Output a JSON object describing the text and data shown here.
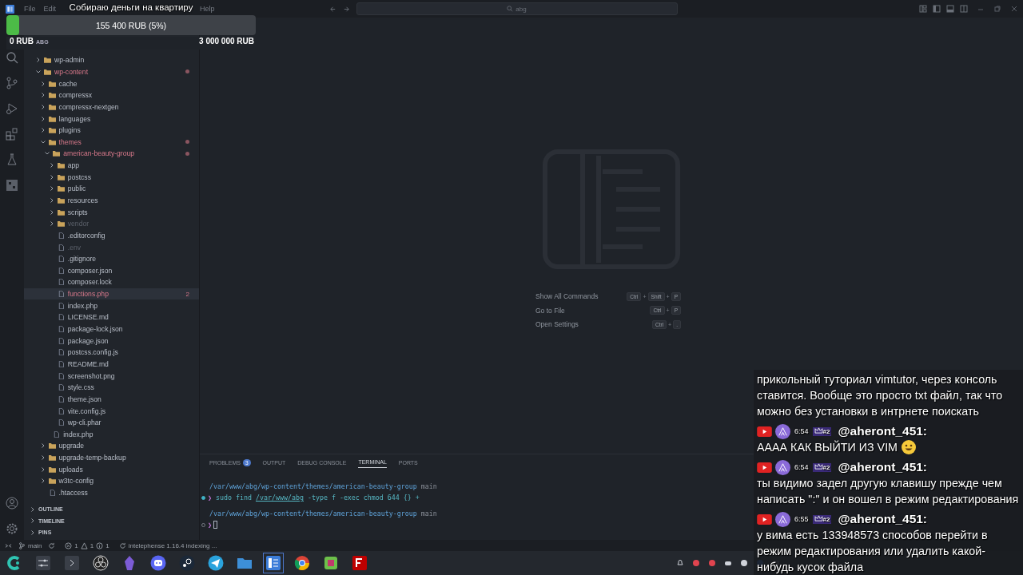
{
  "menu": [
    "File",
    "Edit",
    "Help"
  ],
  "search": {
    "value": "abg"
  },
  "explorer": {
    "tree": [
      {
        "kind": "folder",
        "name": "wp-admin",
        "expanded": false,
        "selected": false,
        "modified": false,
        "ignored": false
      },
      {
        "kind": "folder",
        "name": "wp-content",
        "expanded": true,
        "selected": false,
        "modified": true,
        "ignored": false,
        "children": [
          {
            "kind": "folder",
            "name": "cache",
            "expanded": false,
            "selected": false,
            "modified": false,
            "ignored": false
          },
          {
            "kind": "folder",
            "name": "compressx",
            "expanded": false,
            "selected": false,
            "modified": false,
            "ignored": false
          },
          {
            "kind": "folder",
            "name": "compressx-nextgen",
            "expanded": false,
            "selected": false,
            "modified": false,
            "ignored": false
          },
          {
            "kind": "folder",
            "name": "languages",
            "expanded": false,
            "selected": false,
            "modified": false,
            "ignored": false
          },
          {
            "kind": "folder",
            "name": "plugins",
            "expanded": false,
            "selected": false,
            "modified": false,
            "ignored": false
          },
          {
            "kind": "folder",
            "name": "themes",
            "expanded": true,
            "selected": false,
            "modified": true,
            "ignored": false,
            "children": [
              {
                "kind": "folder",
                "name": "american-beauty-group",
                "expanded": true,
                "selected": false,
                "modified": true,
                "ignored": false,
                "children": [
                  {
                    "kind": "folder",
                    "name": "app",
                    "expanded": false,
                    "selected": false,
                    "modified": false,
                    "ignored": false
                  },
                  {
                    "kind": "folder",
                    "name": "postcss",
                    "expanded": false,
                    "selected": false,
                    "modified": false,
                    "ignored": false
                  },
                  {
                    "kind": "folder",
                    "name": "public",
                    "expanded": false,
                    "selected": false,
                    "modified": false,
                    "ignored": false
                  },
                  {
                    "kind": "folder",
                    "name": "resources",
                    "expanded": false,
                    "selected": false,
                    "modified": false,
                    "ignored": false
                  },
                  {
                    "kind": "folder",
                    "name": "scripts",
                    "expanded": false,
                    "selected": false,
                    "modified": false,
                    "ignored": false
                  },
                  {
                    "kind": "folder",
                    "name": "vendor",
                    "expanded": false,
                    "selected": false,
                    "modified": false,
                    "ignored": true
                  },
                  {
                    "kind": "file",
                    "name": ".editorconfig",
                    "selected": false,
                    "modified": false,
                    "ignored": false
                  },
                  {
                    "kind": "file",
                    "name": ".env",
                    "selected": false,
                    "modified": false,
                    "ignored": true
                  },
                  {
                    "kind": "file",
                    "name": ".gitignore",
                    "selected": false,
                    "modified": false,
                    "ignored": false
                  },
                  {
                    "kind": "file",
                    "name": "composer.json",
                    "selected": false,
                    "modified": false,
                    "ignored": false
                  },
                  {
                    "kind": "file",
                    "name": "composer.lock",
                    "selected": false,
                    "modified": false,
                    "ignored": false
                  },
                  {
                    "kind": "file",
                    "name": "functions.php",
                    "selected": true,
                    "modified": true,
                    "ignored": false,
                    "problems": "2"
                  },
                  {
                    "kind": "file",
                    "name": "index.php",
                    "selected": false,
                    "modified": false,
                    "ignored": false
                  },
                  {
                    "kind": "file",
                    "name": "LICENSE.md",
                    "selected": false,
                    "modified": false,
                    "ignored": false
                  },
                  {
                    "kind": "file",
                    "name": "package-lock.json",
                    "selected": false,
                    "modified": false,
                    "ignored": false
                  },
                  {
                    "kind": "file",
                    "name": "package.json",
                    "selected": false,
                    "modified": false,
                    "ignored": false
                  },
                  {
                    "kind": "file",
                    "name": "postcss.config.js",
                    "selected": false,
                    "modified": false,
                    "ignored": false
                  },
                  {
                    "kind": "file",
                    "name": "README.md",
                    "selected": false,
                    "modified": false,
                    "ignored": false
                  },
                  {
                    "kind": "file",
                    "name": "screenshot.png",
                    "selected": false,
                    "modified": false,
                    "ignored": false
                  },
                  {
                    "kind": "file",
                    "name": "style.css",
                    "selected": false,
                    "modified": false,
                    "ignored": false
                  },
                  {
                    "kind": "file",
                    "name": "theme.json",
                    "selected": false,
                    "modified": false,
                    "ignored": false
                  },
                  {
                    "kind": "file",
                    "name": "vite.config.js",
                    "selected": false,
                    "modified": false,
                    "ignored": false
                  },
                  {
                    "kind": "file",
                    "name": "wp-cli.phar",
                    "selected": false,
                    "modified": false,
                    "ignored": false
                  }
                ]
              },
              {
                "kind": "file",
                "name": "index.php",
                "selected": false,
                "modified": false,
                "ignored": false
              }
            ]
          },
          {
            "kind": "folder",
            "name": "upgrade",
            "expanded": false,
            "selected": false,
            "modified": false,
            "ignored": false
          },
          {
            "kind": "folder",
            "name": "upgrade-temp-backup",
            "expanded": false,
            "selected": false,
            "modified": false,
            "ignored": false
          },
          {
            "kind": "folder",
            "name": "uploads",
            "expanded": false,
            "selected": false,
            "modified": false,
            "ignored": false
          },
          {
            "kind": "folder",
            "name": "w3tc-config",
            "expanded": false,
            "selected": false,
            "modified": false,
            "ignored": false
          },
          {
            "kind": "file",
            "name": ".htaccess",
            "selected": false,
            "modified": false,
            "ignored": false
          }
        ]
      }
    ],
    "sections": [
      {
        "label": "OUTLINE",
        "expanded": false
      },
      {
        "label": "TIMELINE",
        "expanded": false
      },
      {
        "label": "PINS",
        "expanded": false
      }
    ]
  },
  "commands": [
    {
      "label": "Show All Commands",
      "keys": [
        "Ctrl",
        "+",
        "Shift",
        "+",
        "P"
      ]
    },
    {
      "label": "Go to File",
      "keys": [
        "Ctrl",
        "+",
        "P"
      ]
    },
    {
      "label": "Open Settings",
      "keys": [
        "Ctrl",
        "+",
        "."
      ]
    }
  ],
  "panel_tabs": [
    {
      "label": "PROBLEMS",
      "badge": "3",
      "selected": false
    },
    {
      "label": "OUTPUT",
      "selected": false
    },
    {
      "label": "DEBUG CONSOLE",
      "selected": false
    },
    {
      "label": "TERMINAL",
      "selected": true
    },
    {
      "label": "PORTS",
      "selected": false
    }
  ],
  "terminal": [
    {
      "kind": "path",
      "path": "/var/www/abg/wp-content/themes/american-beauty-group",
      "branch": "main"
    },
    {
      "kind": "command",
      "finished": true,
      "prompt": "❯",
      "command": "sudo find",
      "link": "/var/www/abg",
      "rest": "-type f -exec chmod 644 {} +"
    },
    {
      "kind": "path",
      "path": "/var/www/abg/wp-content/themes/american-beauty-group",
      "branch": "main"
    },
    {
      "kind": "command",
      "finished": false,
      "prompt": "❯",
      "cursor": true
    }
  ],
  "status_bar": {
    "branch": "main",
    "errors": "1",
    "warnings": "1",
    "infos": "1",
    "task": "intelephense 1.16.4 indexing ..."
  },
  "goal": {
    "title": "Собираю деньги на квартиру",
    "level": 0.05,
    "amount": "155 400 RUB (5%)",
    "min": "0 RUB",
    "tag": "ABG",
    "max": "3 000 000 RUB"
  },
  "chat": [
    {
      "text": "прикольный туториал vimtutor, через консоль ставится. Вообще это просто txt файл, так что можно без установки в интрнете поискать"
    },
    {
      "time": "6:54",
      "badge": "#2",
      "author": "@aheront_451:",
      "text": "АААА КАК ВЫЙТИ ИЗ VIM",
      "emoji": true
    },
    {
      "time": "6:54",
      "badge": "#2",
      "author": "@aheront_451:",
      "text": "ты видимо задел другую клавишу прежде чем написать \":\" и он вошел в режим редактирования"
    },
    {
      "time": "6:55",
      "badge": "#2",
      "author": "@aheront_451:",
      "text": "у вима есть 133948573 способов перейти в режим редактирования или удалить какой-нибудь кусок файла"
    }
  ]
}
